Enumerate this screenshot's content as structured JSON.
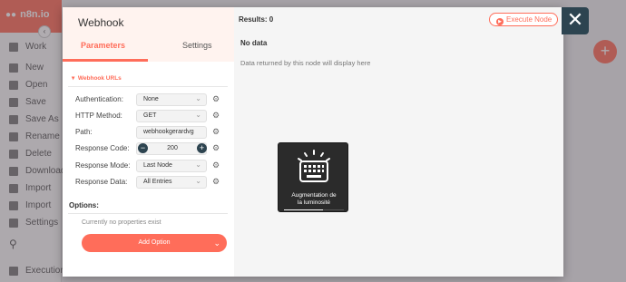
{
  "background": {
    "brand": "n8n.io",
    "workflow_label": "Work",
    "menu_items": [
      "New",
      "Open",
      "Save",
      "Save As",
      "Rename",
      "Delete",
      "Download",
      "Import",
      "Import",
      "Settings"
    ],
    "bottom_bar_label": "Executions"
  },
  "node": {
    "title": "Webhook",
    "tabs": [
      "Parameters",
      "Settings"
    ],
    "active_tab": "Parameters",
    "section_title": "Webhook URLs",
    "params": [
      {
        "label": "Authentication:",
        "value": "None",
        "kind": "select"
      },
      {
        "label": "HTTP Method:",
        "value": "GET",
        "kind": "select"
      },
      {
        "label": "Path:",
        "value": "webhookgerardvg",
        "kind": "text"
      },
      {
        "label": "Response Code:",
        "value": "200",
        "kind": "number"
      },
      {
        "label": "Response Mode:",
        "value": "Last Node",
        "kind": "select"
      },
      {
        "label": "Response Data:",
        "value": "All Entries",
        "kind": "select"
      }
    ],
    "options_label": "Options:",
    "no_properties": "Currently no properties exist",
    "add_option": "Add Option"
  },
  "output": {
    "results": "Results: 0",
    "execute_label": "Execute Node",
    "no_data_title": "No data",
    "no_data_sub": "Data returned by this node will display here"
  },
  "osd": {
    "label_line1": "Augmentation de",
    "label_line2": "la luminosité",
    "level": 0.65
  },
  "colors": {
    "accent": "#ff6d5a",
    "close_bg": "#2d4450"
  },
  "icons": {
    "close": "close-icon",
    "gear": "gear-icon",
    "play": "play-icon",
    "osd": "keyboard-backlight-icon"
  }
}
